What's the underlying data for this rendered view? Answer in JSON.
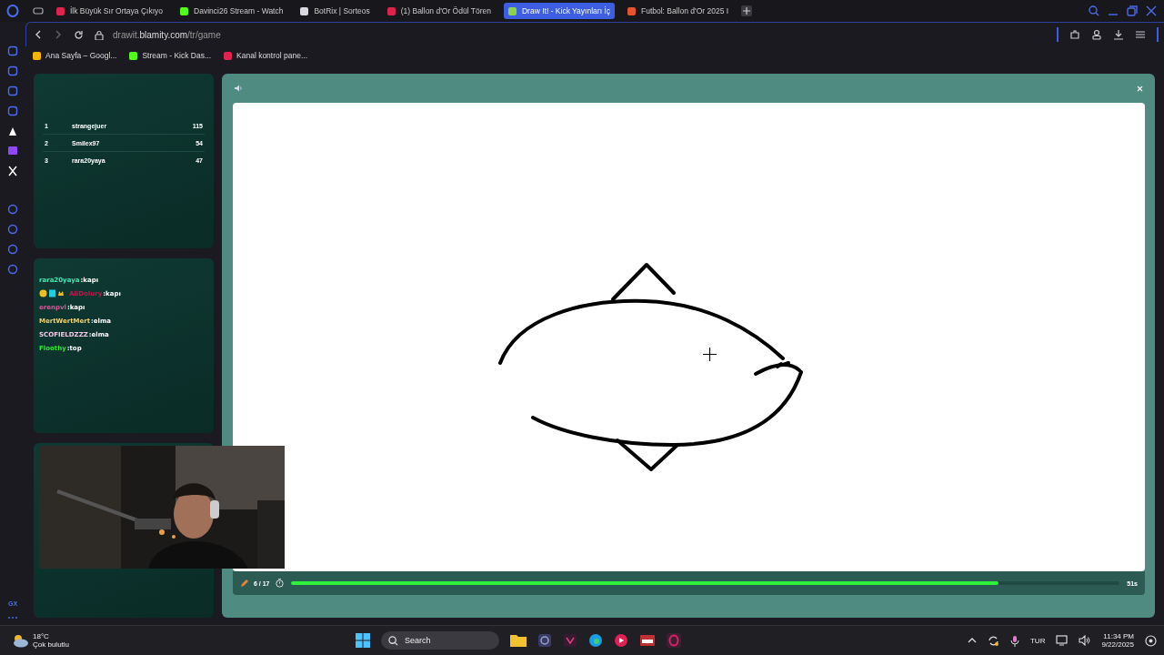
{
  "tabs": [
    {
      "title": "İlk Büyük Sır Ortaya Çıkıyo",
      "color": "#e0234e",
      "selected": false
    },
    {
      "title": "Davinci26 Stream - Watch",
      "color": "#53fc18",
      "selected": false
    },
    {
      "title": "BotRix | Sorteos",
      "color": "#d8d8e0",
      "selected": false
    },
    {
      "title": "(1) Ballon d'Or Ödül Tören",
      "color": "#e0234e",
      "selected": false
    },
    {
      "title": "Draw It! - Kick Yayınları İç",
      "color": "#8bd34a",
      "selected": true
    },
    {
      "title": "Futbol: Ballon d'Or 2025 I",
      "color": "#e8542a",
      "selected": false
    }
  ],
  "address": {
    "prefix": "drawit.",
    "domain": "blamity.com",
    "path": "/tr/game"
  },
  "bookmarks": [
    {
      "title": "Ana Sayfa – Googl...",
      "color": "#f4b400"
    },
    {
      "title": "Stream - Kick Das...",
      "color": "#53fc18"
    },
    {
      "title": "Kanal kontrol pane...",
      "color": "#e0234e"
    }
  ],
  "leaderboard": [
    {
      "rank": "1",
      "name": "strangejuer",
      "score": "115"
    },
    {
      "rank": "2",
      "name": "Smilex97",
      "score": "54"
    },
    {
      "rank": "3",
      "name": "rara20yaya",
      "score": "47"
    }
  ],
  "chat": [
    {
      "user": "rara20yaya",
      "color": "#3ee6b0",
      "message": ":kapı",
      "badges": false
    },
    {
      "user": "AliDolury",
      "color": "#d0104c",
      "message": ":kapı",
      "badges": true
    },
    {
      "user": "erenpvl",
      "color": "#d45a9a",
      "message": ":kapı",
      "badges": false
    },
    {
      "user": "MertWertMert",
      "color": "#f0d070",
      "message": ":elma",
      "badges": false
    },
    {
      "user": "SCOFIELDZZZ",
      "color": "#f0c8e8",
      "message": ":elma",
      "badges": false
    },
    {
      "user": "Floothy",
      "color": "#30e830",
      "message": ":top",
      "badges": false
    }
  ],
  "game": {
    "round": "6 / 17",
    "timer": "51s",
    "level": 0.854
  },
  "sidebar_footer": "GX",
  "taskbar": {
    "temp": "18°C",
    "weather": "Çok bulutlu",
    "search": "Search",
    "language": "TUR",
    "time": "11:34 PM",
    "date": "9/22/2025"
  }
}
